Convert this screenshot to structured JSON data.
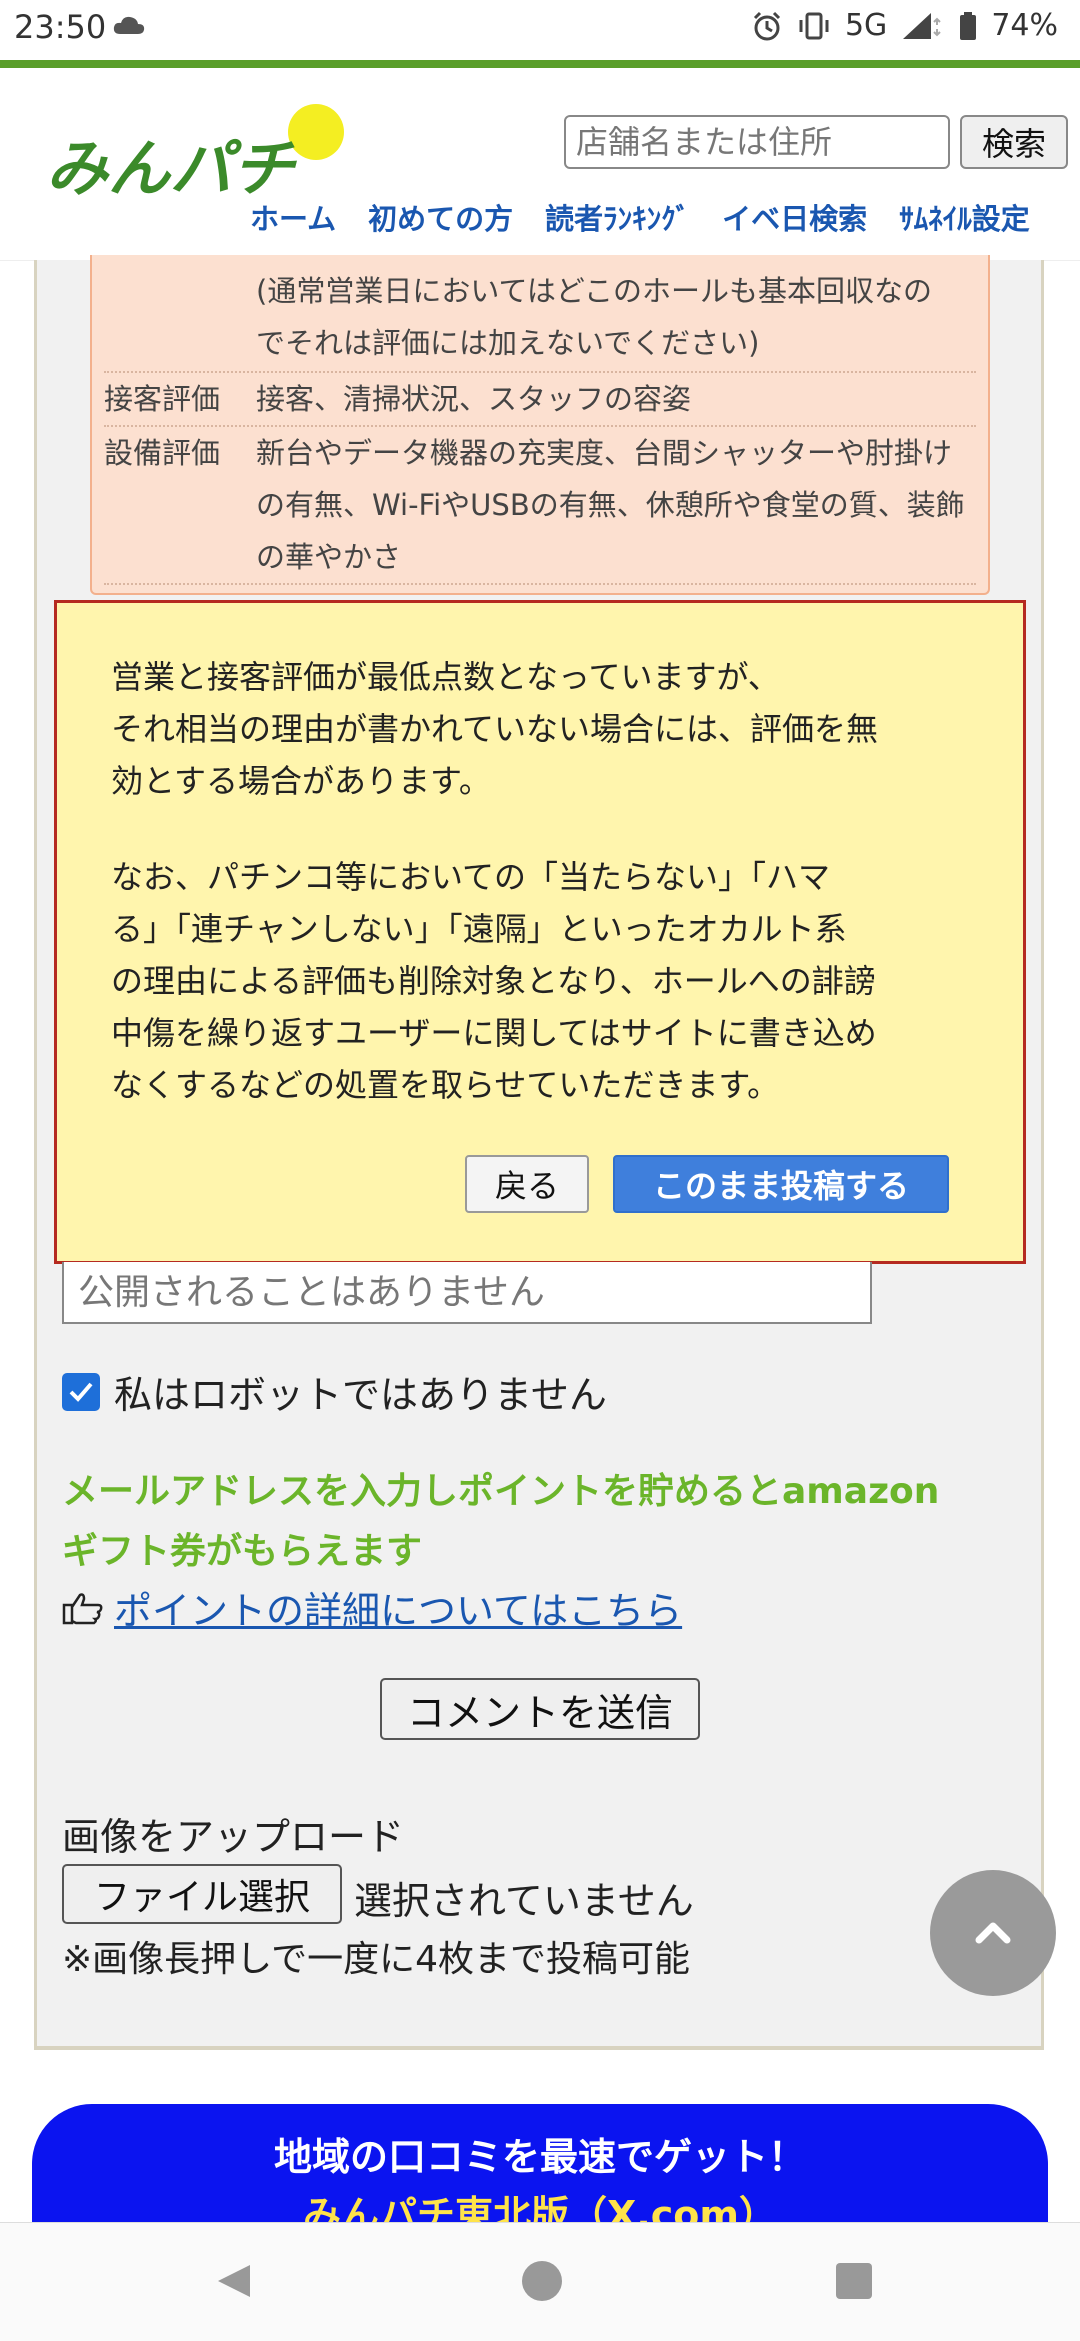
{
  "status_bar": {
    "time": "23:50",
    "network": "5G",
    "battery": "74%"
  },
  "header": {
    "logo_text": "みんパチ",
    "search_placeholder": "店舗名または住所",
    "search_button": "検索",
    "nav": [
      "ホーム",
      "初めての方",
      "読者ﾗﾝｷﾝｸﾞ",
      "イベ日検索",
      "ｻﾑﾈｲﾙ設定"
    ]
  },
  "guide": {
    "top_text_1": "(通常営業日においてはどこのホールも基本回収なの",
    "top_text_2": "でそれは評価には加えないでください)",
    "rows": [
      {
        "label": "接客評価",
        "text": "接客、清掃状況、スタッフの容姿"
      },
      {
        "label": "設備評価",
        "text_1": "新台やデータ機器の充実度、台間シャッターや肘掛け",
        "text_2": "の有無、Wi-FiやUSBの有無、休憩所や食堂の質、装飾",
        "text_3": "の華やかさ"
      }
    ]
  },
  "dialog": {
    "p1_l1": "営業と接客評価が最低点数となっていますが、",
    "p1_l2": "それ相当の理由が書かれていない場合には、評価を無",
    "p1_l3": "効とする場合があります。",
    "p2_l1": "なお、パチンコ等においての「当たらない」「ハマ",
    "p2_l2": "る」「連チャンしない」「遠隔」といったオカルト系",
    "p2_l3": "の理由による評価も削除対象となり、ホールへの誹謗",
    "p2_l4": "中傷を繰り返すユーザーに関してはサイトに書き込め",
    "p2_l5": "なくするなどの処置を取らせていただきます。",
    "back_button": "戻る",
    "post_button": "このまま投稿する"
  },
  "form": {
    "email_placeholder": "公開されることはありません",
    "robot_label": "私はロボットではありません",
    "robot_checked": true,
    "promo_l1": "メールアドレスを入力しポイントを貯めるとamazon",
    "promo_l2": "ギフト券がもらえます",
    "point_link": "ポイントの詳細についてはこちら",
    "submit_button": "コメントを送信",
    "upload_label": "画像をアップロード",
    "file_button": "ファイル選択",
    "file_status": "選択されていません",
    "upload_note": "※画像長押しで一度に4枚まで投稿可能"
  },
  "banner": {
    "line1": "地域の口コミを最速でゲット！",
    "line2": "みんパチ東北版（X.com）"
  },
  "colors": {
    "accent_green": "#5a9e2a",
    "link_blue": "#1a57b0",
    "dialog_bg": "#fff5ad",
    "dialog_border": "#b52a20",
    "post_button": "#3f7fdc",
    "banner_blue": "#0b14f0"
  }
}
